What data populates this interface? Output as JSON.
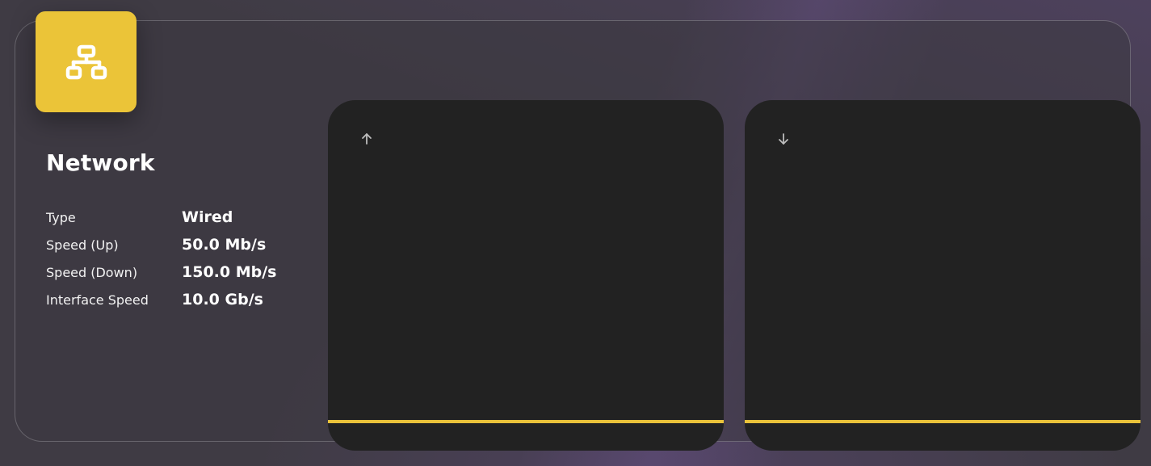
{
  "colors": {
    "accent": "#ebc438",
    "card_bg": "#222222",
    "background": "#3f3b44"
  },
  "network": {
    "icon": "network-icon",
    "title": "Network",
    "rows": [
      {
        "label": "Type",
        "value": "Wired"
      },
      {
        "label": "Speed (Up)",
        "value": "50.0 Mb/s"
      },
      {
        "label": "Speed (Down)",
        "value": "150.0 Mb/s"
      },
      {
        "label": "Interface Speed",
        "value": "10.0 Gb/s"
      }
    ]
  },
  "graphs": {
    "upload": {
      "icon": "arrow-up-icon"
    },
    "download": {
      "icon": "arrow-down-icon"
    }
  }
}
